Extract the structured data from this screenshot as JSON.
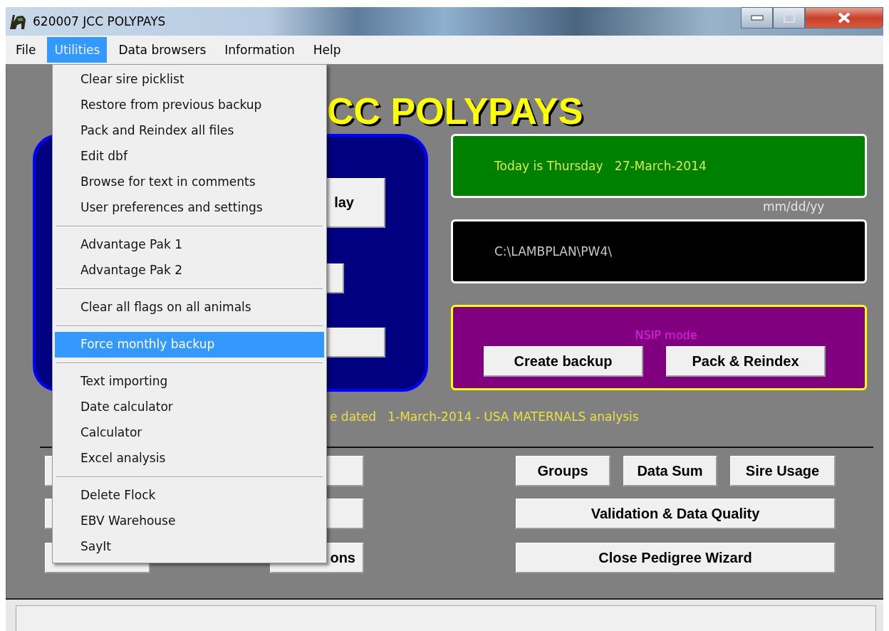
{
  "window": {
    "title": "620007 JCC POLYPAYS"
  },
  "menu_bar": [
    {
      "label": "File",
      "selected": false
    },
    {
      "label": "Utilities",
      "selected": true
    },
    {
      "label": "Data browsers",
      "selected": false
    },
    {
      "label": "Information",
      "selected": false
    },
    {
      "label": "Help",
      "selected": false
    }
  ],
  "utilities_menu": [
    {
      "kind": "item",
      "label": "Clear sire picklist",
      "selected": false
    },
    {
      "kind": "item",
      "label": "Restore from previous backup",
      "selected": false
    },
    {
      "kind": "item",
      "label": "Pack and Reindex all files",
      "selected": false
    },
    {
      "kind": "item",
      "label": "Edit dbf",
      "selected": false
    },
    {
      "kind": "item",
      "label": "Browse for text in comments",
      "selected": false
    },
    {
      "kind": "item",
      "label": "User preferences and settings",
      "selected": false
    },
    {
      "kind": "separator"
    },
    {
      "kind": "item",
      "label": "Advantage Pak 1",
      "selected": false
    },
    {
      "kind": "item",
      "label": "Advantage Pak 2",
      "selected": false
    },
    {
      "kind": "separator"
    },
    {
      "kind": "item",
      "label": "Clear all flags on all animals",
      "selected": false
    },
    {
      "kind": "separator"
    },
    {
      "kind": "item",
      "label": "Force monthly backup",
      "selected": true
    },
    {
      "kind": "separator"
    },
    {
      "kind": "item",
      "label": "Text importing",
      "selected": false
    },
    {
      "kind": "item",
      "label": "Date calculator",
      "selected": false
    },
    {
      "kind": "item",
      "label": "Calculator",
      "selected": false
    },
    {
      "kind": "item",
      "label": "Excel analysis",
      "selected": false
    },
    {
      "kind": "separator"
    },
    {
      "kind": "item",
      "label": "Delete Flock",
      "selected": false
    },
    {
      "kind": "item",
      "label": "EBV Warehouse",
      "selected": false
    },
    {
      "kind": "item",
      "label": "SayIt",
      "selected": false
    }
  ],
  "heading": "CC POLYPAYS",
  "left_panel_buttons": [
    {
      "kind": "labeled",
      "label": "lay"
    },
    {
      "kind": "blank"
    },
    {
      "kind": "blank"
    }
  ],
  "date_box": "Today is Thursday   27-March-2014",
  "date_format": "mm/dd/yy",
  "path_box": "C:\\LAMBPLAN\\PW4\\",
  "nsip_panel": {
    "label": "NSIP mode",
    "buttons": [
      "Create backup",
      "Pack & Reindex"
    ]
  },
  "analysis_note": "e dated   1-March-2014 - USA MATERNALS analysis",
  "lower_left_buttons": [
    {
      "kind": "blank"
    },
    {
      "kind": "blank"
    },
    {
      "kind": "blank"
    },
    {
      "kind": "blank"
    },
    {
      "kind": "blank"
    },
    {
      "kind": "labeled",
      "label": "ons"
    }
  ],
  "lower_right_buttons": [
    "Groups",
    "Data Sum",
    "Sire Usage",
    "Validation & Data Quality",
    "Close Pedigree Wizard"
  ]
}
